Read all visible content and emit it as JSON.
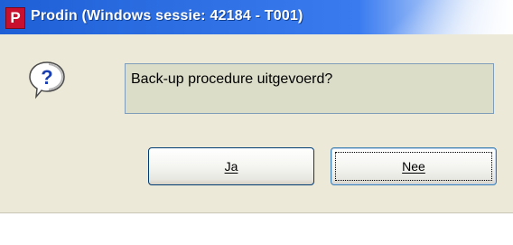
{
  "window": {
    "app_icon_letter": "P",
    "title": "Prodin (Windows sessie: 42184 - T001)"
  },
  "dialog": {
    "icon": "question-icon",
    "message": "Back-up procedure uitgevoerd?",
    "buttons": {
      "yes_label": "Ja",
      "no_label": "Nee"
    }
  },
  "colors": {
    "titlebar": "#2d6fe3",
    "client_bg": "#ece9d8",
    "message_bg": "#dcddc9",
    "app_icon_bg": "#c8102e"
  }
}
